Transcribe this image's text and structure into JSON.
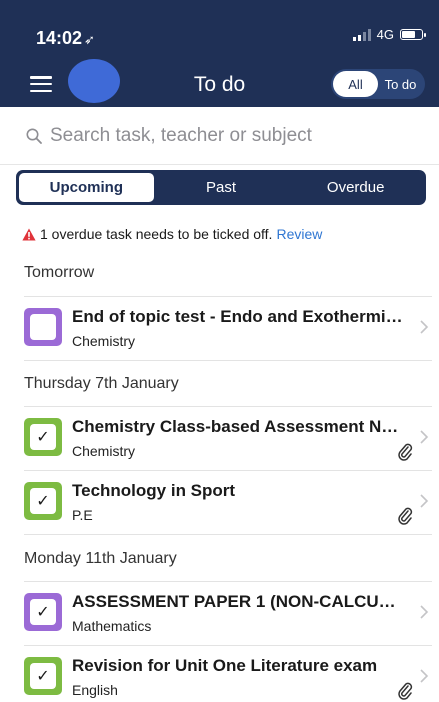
{
  "status_bar": {
    "time": "14:02",
    "network": "4G"
  },
  "header": {
    "title": "To do",
    "toggle": {
      "all_label": "All",
      "todo_label": "To do"
    }
  },
  "search": {
    "placeholder": "Search task, teacher or subject"
  },
  "tabs": [
    {
      "label": "Upcoming",
      "active": true
    },
    {
      "label": "Past",
      "active": false
    },
    {
      "label": "Overdue",
      "active": false
    }
  ],
  "alert": {
    "text": "1 overdue task needs to be ticked off.",
    "link": "Review"
  },
  "colors": {
    "header": "#1f3056",
    "purple": "#9b6ad6",
    "green": "#7dbb42",
    "link": "#2f76d2",
    "alert": "#e0333a"
  },
  "sections": [
    {
      "label": "Tomorrow",
      "tasks": [
        {
          "title": "End of topic test - Endo and Exothermic…",
          "subject": "Chemistry",
          "color": "purple",
          "checked": false,
          "attachment": false
        }
      ]
    },
    {
      "label": "Thursday 7th January",
      "tasks": [
        {
          "title": "Chemistry Class-based Assessment Ne…",
          "subject": "Chemistry",
          "color": "green",
          "checked": true,
          "attachment": true
        },
        {
          "title": "Technology in Sport",
          "subject": "P.E",
          "color": "green",
          "checked": true,
          "attachment": true
        }
      ]
    },
    {
      "label": "Monday 11th January",
      "tasks": [
        {
          "title": "ASSESSMENT PAPER 1 (NON-CALCULA…",
          "subject": "Mathematics",
          "color": "purple",
          "checked": true,
          "attachment": false
        },
        {
          "title": "Revision for Unit One Literature exam",
          "subject": "English",
          "color": "green",
          "checked": true,
          "attachment": true
        }
      ]
    }
  ]
}
